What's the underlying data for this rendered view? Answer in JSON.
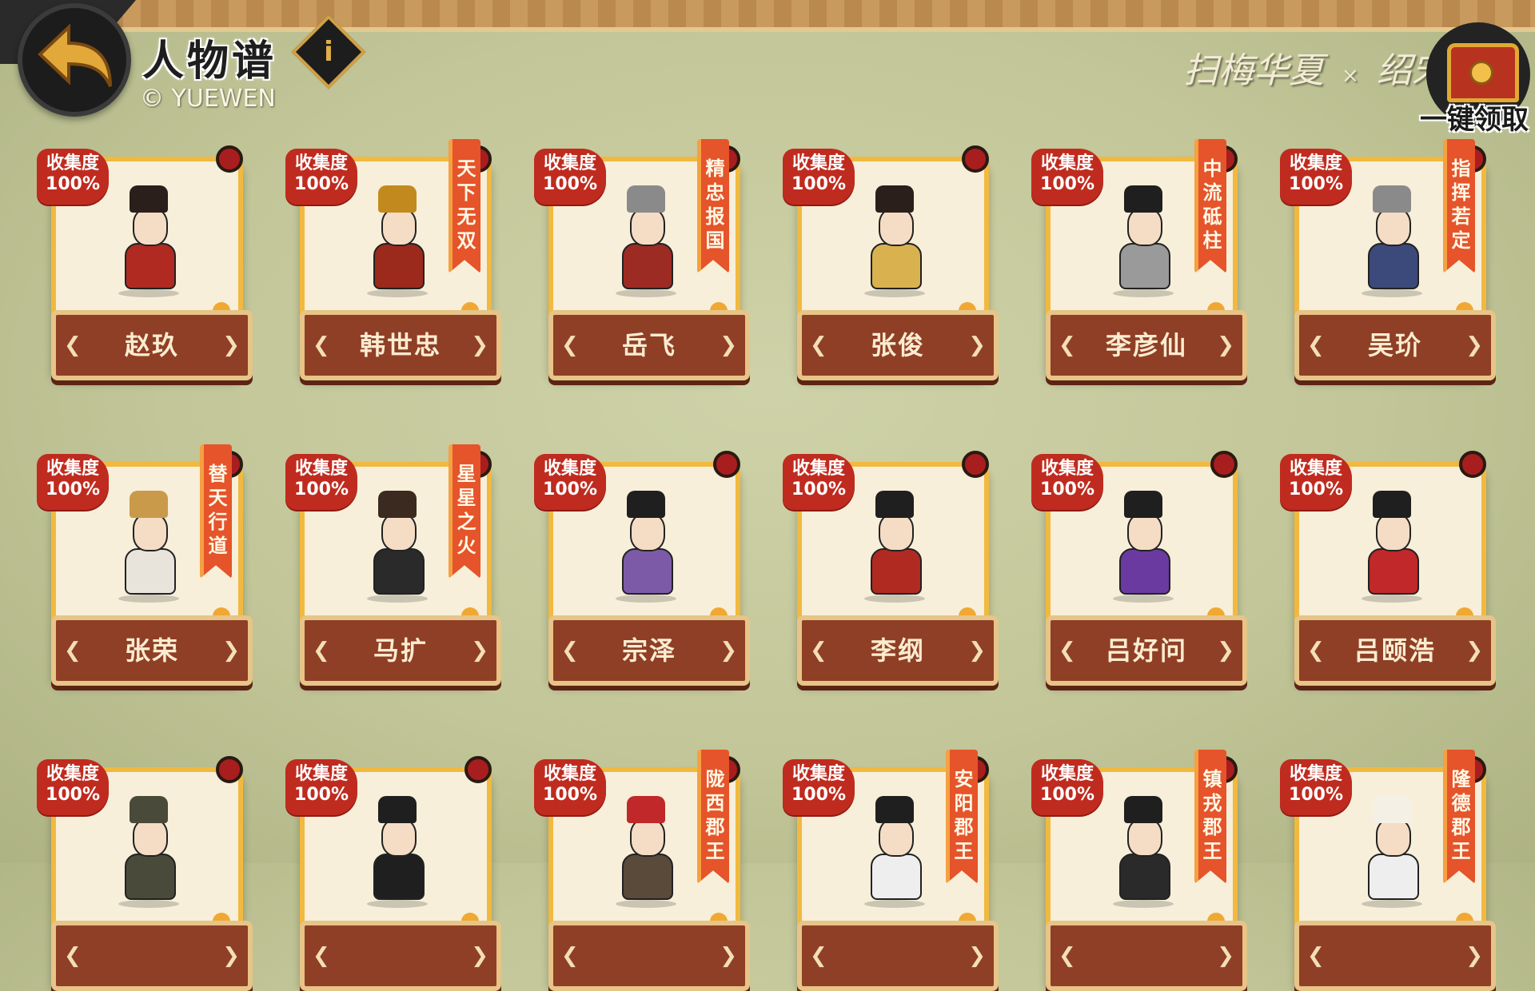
{
  "header": {
    "title": "人物谱",
    "copyright": "© YUEWEN",
    "logo_left": "扫梅华夏",
    "logo_x": "×",
    "logo_right": "绍宋",
    "claim_all_label": "一键领取"
  },
  "icons": {
    "back": "back-arrow-icon",
    "info": "info-icon",
    "claim": "treasure-chest-icon"
  },
  "colors": {
    "card_frame": "#f1b93f",
    "badge": "#c02b1f",
    "nameplate": "#8f3f26",
    "ribbon": "#e5542a",
    "notification_dot": "#a81e1e"
  },
  "cards": [
    {
      "name": "赵玖",
      "badge_top": "收集度",
      "badge_pct": "100%",
      "ribbon": "",
      "robe": "#b02a22",
      "hat": "#2a1f1a"
    },
    {
      "name": "韩世忠",
      "badge_top": "收集度",
      "badge_pct": "100%",
      "ribbon": "天下无双",
      "robe": "#9b2a1c",
      "hat": "#c28a1e"
    },
    {
      "name": "岳飞",
      "badge_top": "收集度",
      "badge_pct": "100%",
      "ribbon": "精忠报国",
      "robe": "#9c2b24",
      "hat": "#8a8a8a"
    },
    {
      "name": "张俊",
      "badge_top": "收集度",
      "badge_pct": "100%",
      "ribbon": "",
      "robe": "#d9b24f",
      "hat": "#2a1f1a"
    },
    {
      "name": "李彦仙",
      "badge_top": "收集度",
      "badge_pct": "100%",
      "ribbon": "中流砥柱",
      "robe": "#9a9a9a",
      "hat": "#1f1f1f"
    },
    {
      "name": "吴玠",
      "badge_top": "收集度",
      "badge_pct": "100%",
      "ribbon": "指挥若定",
      "robe": "#3b4a7a",
      "hat": "#8a8a8a"
    },
    {
      "name": "张荣",
      "badge_top": "收集度",
      "badge_pct": "100%",
      "ribbon": "替天行道",
      "robe": "#e8e4dc",
      "hat": "#c89a4a"
    },
    {
      "name": "马扩",
      "badge_top": "收集度",
      "badge_pct": "100%",
      "ribbon": "星星之火",
      "robe": "#2a2a2a",
      "hat": "#3a2a20"
    },
    {
      "name": "宗泽",
      "badge_top": "收集度",
      "badge_pct": "100%",
      "ribbon": "",
      "robe": "#7d5aa8",
      "hat": "#1f1f1f"
    },
    {
      "name": "李纲",
      "badge_top": "收集度",
      "badge_pct": "100%",
      "ribbon": "",
      "robe": "#b02a22",
      "hat": "#1f1f1f"
    },
    {
      "name": "吕好问",
      "badge_top": "收集度",
      "badge_pct": "100%",
      "ribbon": "",
      "robe": "#6a3aa0",
      "hat": "#1f1f1f"
    },
    {
      "name": "吕颐浩",
      "badge_top": "收集度",
      "badge_pct": "100%",
      "ribbon": "",
      "robe": "#c0282a",
      "hat": "#1f1f1f"
    },
    {
      "name": "",
      "badge_top": "收集度",
      "badge_pct": "100%",
      "ribbon": "",
      "robe": "#4a4a3a",
      "hat": "#4a4a3a"
    },
    {
      "name": "",
      "badge_top": "收集度",
      "badge_pct": "100%",
      "ribbon": "",
      "robe": "#1f1f1f",
      "hat": "#1f1f1f"
    },
    {
      "name": "",
      "badge_top": "收集度",
      "badge_pct": "100%",
      "ribbon": "陇西郡王",
      "robe": "#5a4a3a",
      "hat": "#c0282a"
    },
    {
      "name": "",
      "badge_top": "收集度",
      "badge_pct": "100%",
      "ribbon": "安阳郡王",
      "robe": "#eee",
      "hat": "#1f1f1f"
    },
    {
      "name": "",
      "badge_top": "收集度",
      "badge_pct": "100%",
      "ribbon": "镇戎郡王",
      "robe": "#2a2a2a",
      "hat": "#1f1f1f"
    },
    {
      "name": "",
      "badge_top": "收集度",
      "badge_pct": "100%",
      "ribbon": "隆德郡王",
      "robe": "#eee",
      "hat": "#f4f0e6"
    }
  ]
}
